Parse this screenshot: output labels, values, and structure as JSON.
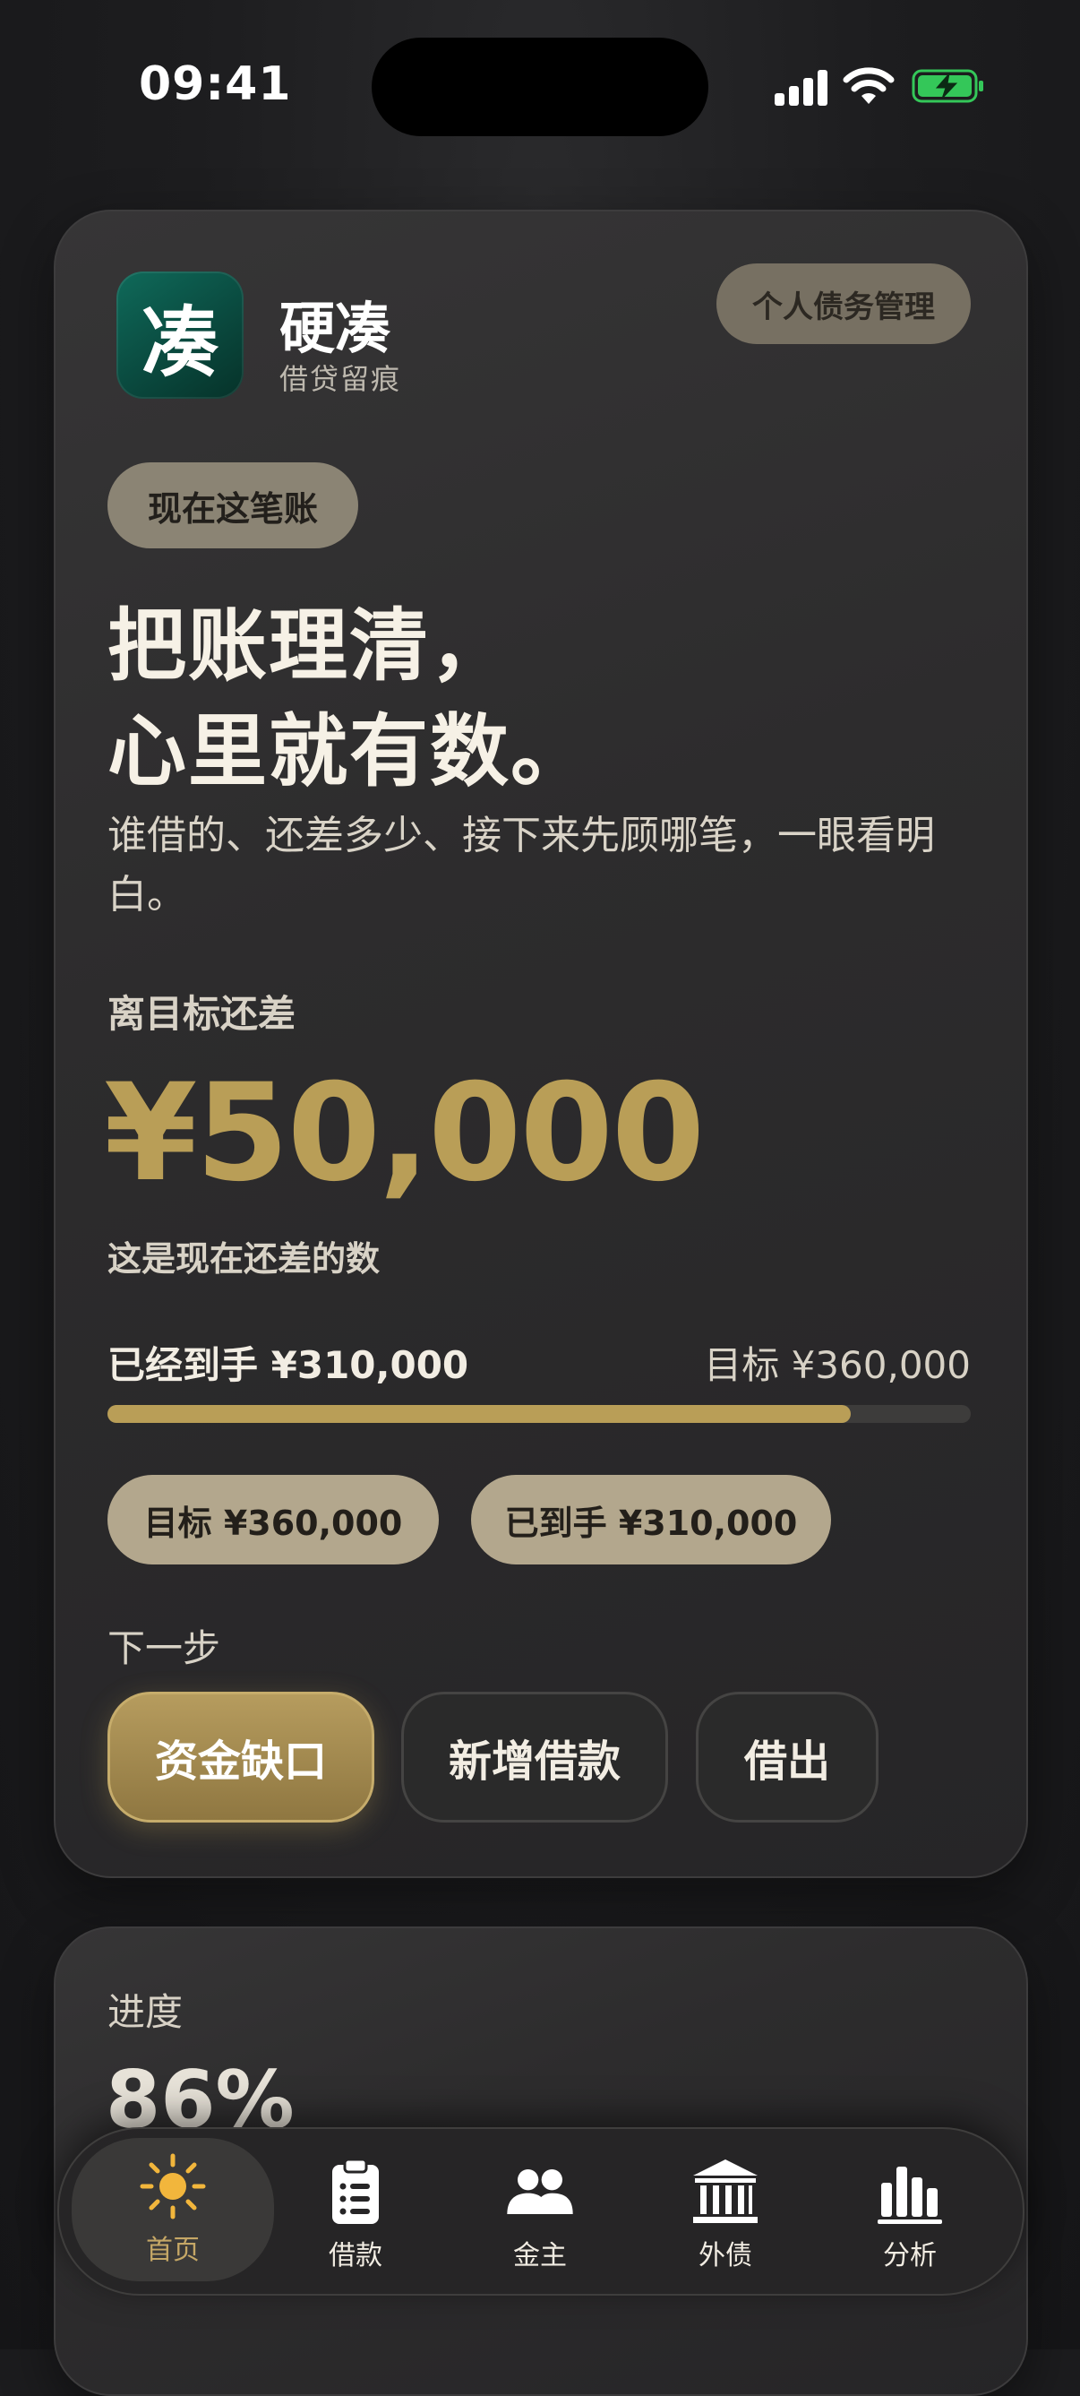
{
  "status": {
    "time": "09:41"
  },
  "app": {
    "icon_char": "凑",
    "name": "硬凑",
    "subtitle": "借贷留痕",
    "tag": "个人债务管理"
  },
  "hero": {
    "pill": "现在这笔账",
    "headline_1": "把账理清，",
    "headline_2": "心里就有数。",
    "description": "谁借的、还差多少、接下来先顾哪笔，一眼看明白。"
  },
  "gap": {
    "label": "离目标还差",
    "amount": "¥50,000",
    "note": "这是现在还差的数",
    "received_text": "已经到手 ¥310,000",
    "target_text": "目标 ¥360,000",
    "progress_fraction": 0.861,
    "pill_target": "目标 ¥360,000",
    "pill_received": "已到手 ¥310,000"
  },
  "next_step": {
    "label": "下一步",
    "actions": [
      "资金缺口",
      "新增借款",
      "借出"
    ]
  },
  "progress_card": {
    "label": "进度",
    "value": "86%"
  },
  "tabbar": {
    "items": [
      {
        "label": "首页",
        "icon": "sun-icon",
        "active": true
      },
      {
        "label": "借款",
        "icon": "clipboard-list-icon",
        "active": false
      },
      {
        "label": "金主",
        "icon": "people-icon",
        "active": false
      },
      {
        "label": "外债",
        "icon": "bank-icon",
        "active": false
      },
      {
        "label": "分析",
        "icon": "bar-chart-icon",
        "active": false
      }
    ]
  },
  "colors": {
    "accent": "#b99e57",
    "background": "#1c1c1e",
    "card": "#2d2c2d",
    "app_icon": "#0a4a3f"
  }
}
